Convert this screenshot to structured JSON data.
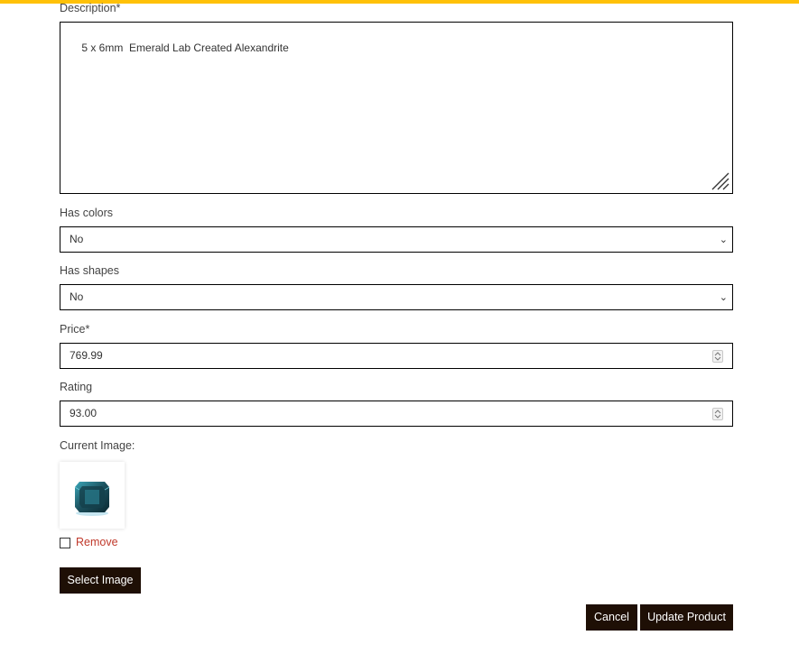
{
  "form": {
    "description": {
      "label": "Description*",
      "value": "5 x 6mm  Emerald Lab Created Alexandrite"
    },
    "has_colors": {
      "label": "Has colors",
      "value": "No"
    },
    "has_shapes": {
      "label": "Has shapes",
      "value": "No"
    },
    "price": {
      "label": "Price*",
      "value": "769.99"
    },
    "rating": {
      "label": "Rating",
      "value": "93.00"
    },
    "current_image": {
      "label": "Current Image:"
    },
    "remove_label": "Remove",
    "select_image_label": "Select Image",
    "cancel_label": "Cancel",
    "update_label": "Update Product"
  },
  "colors": {
    "accent_bar": "#ffc107",
    "button_bg": "#1e0f05",
    "remove_text": "#c0392b"
  },
  "icons": {
    "dropdown": "chevron-down-icon",
    "spinner": "number-spinner-icon",
    "resize": "resize-handle-icon"
  }
}
